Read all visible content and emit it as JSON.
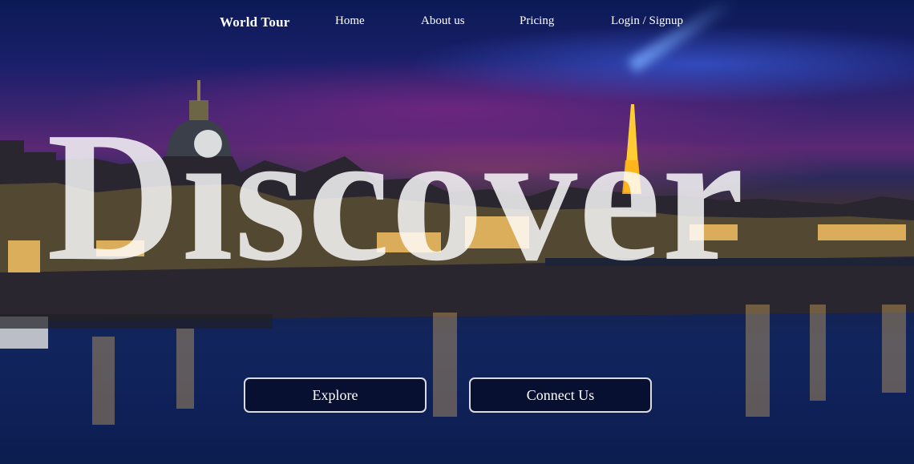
{
  "nav": {
    "brand": "World Tour",
    "links": [
      {
        "label": "Home"
      },
      {
        "label": "About us"
      },
      {
        "label": "Pricing"
      },
      {
        "label": "Login / Signup"
      }
    ]
  },
  "hero": {
    "headline": "Discover",
    "background_icon": "paris-night-skyline-image"
  },
  "actions": {
    "explore_label": "Explore",
    "connect_label": "Connect Us"
  },
  "colors": {
    "sky_top": "#0b1a55",
    "sky_purple": "#5b2874",
    "water": "#142b63",
    "text": "#ffffff"
  }
}
